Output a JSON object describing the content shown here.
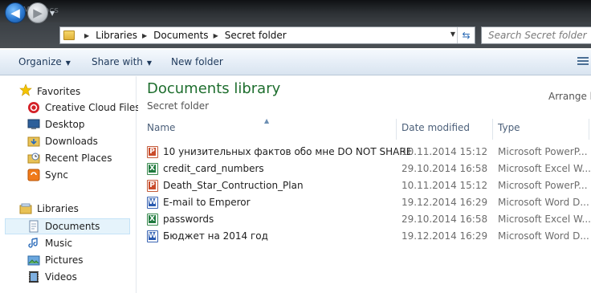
{
  "window": {
    "title": "My docs"
  },
  "nav": {
    "back_glyph": "◀",
    "forward_glyph": "▶",
    "history_glyph": "▼"
  },
  "address": {
    "crumbs": [
      "Libraries",
      "Documents",
      "Secret folder"
    ],
    "search_placeholder": "Search Secret folder"
  },
  "toolbar": {
    "organize": "Organize",
    "share_with": "Share with",
    "new_folder": "New folder"
  },
  "sidebar": {
    "favorites_label": "Favorites",
    "favorites": [
      "Creative Cloud Files",
      "Desktop",
      "Downloads",
      "Recent Places",
      "Sync"
    ],
    "libraries_label": "Libraries",
    "libraries": [
      "Documents",
      "Music",
      "Pictures",
      "Videos"
    ]
  },
  "main": {
    "title": "Documents library",
    "subtitle": "Secret folder",
    "arrange_by": "Arrange by",
    "columns": {
      "name": "Name",
      "date": "Date modified",
      "type": "Type"
    },
    "files": [
      {
        "name": "10 унизительных фактов обо мне DO NOT SHARE",
        "date": "10.11.2014 15:12",
        "type": "Microsoft PowerP...",
        "icon": "ppt"
      },
      {
        "name": "credit_card_numbers",
        "date": "29.10.2014 16:58",
        "type": "Microsoft Excel W...",
        "icon": "xls"
      },
      {
        "name": "Death_Star_Contruction_Plan",
        "date": "10.11.2014 15:12",
        "type": "Microsoft PowerP...",
        "icon": "ppt"
      },
      {
        "name": "E-mail to Emperor",
        "date": "19.12.2014 16:29",
        "type": "Microsoft Word D...",
        "icon": "doc"
      },
      {
        "name": "passwords",
        "date": "29.10.2014 16:58",
        "type": "Microsoft Excel W...",
        "icon": "xls"
      },
      {
        "name": "Бюджет на 2014 год",
        "date": "19.12.2014 16:29",
        "type": "Microsoft Word D...",
        "icon": "doc"
      }
    ]
  },
  "colors": {
    "library_title": "#1e6e2e",
    "selection": "#e5f3fb"
  }
}
